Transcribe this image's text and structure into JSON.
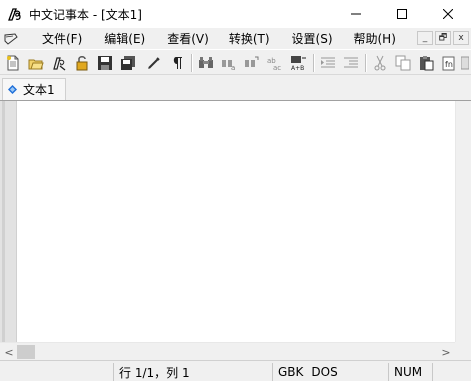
{
  "window": {
    "title": "中文记事本 - [文本1]",
    "controls": [
      "minimize-icon",
      "maximize-icon",
      "close-icon"
    ]
  },
  "menu": {
    "items": [
      "文件(F)",
      "编辑(E)",
      "查看(V)",
      "转换(T)",
      "设置(S)",
      "帮助(H)"
    ],
    "mdi_controls": [
      "_",
      "🗗",
      "x"
    ]
  },
  "toolbar": {
    "icons": [
      "new-file-icon",
      "open-folder-icon",
      "pen-icon",
      "lock-icon",
      "save-icon",
      "save-all-icon",
      "pencil-icon",
      "pilcrow-icon",
      "find-icon",
      "find-next-icon",
      "replace-icon",
      "convert-case-icon",
      "batch-replace-icon",
      "indent-icon",
      "outdent-icon",
      "cut-icon",
      "copy-icon",
      "paste-icon",
      "clipboard-icon",
      "more-icon"
    ]
  },
  "tabs": [
    {
      "label": "文本1",
      "active": true
    }
  ],
  "editor": {
    "content": ""
  },
  "status": {
    "position": "行 1/1，列 1",
    "encoding": "GBK",
    "line_ending": "DOS",
    "numlock": "NUM"
  },
  "colors": {
    "background": "#f0f0f0",
    "editor_bg": "#ffffff",
    "tab_icon": "#1e6fd9"
  }
}
